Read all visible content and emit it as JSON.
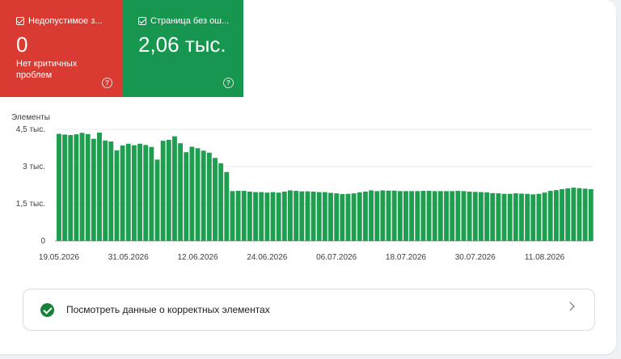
{
  "tiles": [
    {
      "title": "Недопустимое з...",
      "value": "0",
      "subtitle": "Нет критичных проблем",
      "color": "#d93b33"
    },
    {
      "title": "Страница без ош...",
      "value": "2,06 тыс.",
      "subtitle": "",
      "color": "#17964f"
    }
  ],
  "chart_data": {
    "type": "bar",
    "ylabel": "Элементы",
    "ylim": [
      0,
      4500
    ],
    "y_ticks": [
      "4,5 тыс.",
      "3 тыс.",
      "1,5 тыс.",
      "0"
    ],
    "y_tick_values": [
      4500,
      3000,
      1500,
      0
    ],
    "x_tick_labels": [
      "19.05.2026",
      "31.05.2026",
      "12.06.2026",
      "24.06.2026",
      "06.07.2026",
      "18.07.2026",
      "30.07.2026",
      "11.08.2026"
    ],
    "bar_color": "#1e9e4f",
    "values": [
      4320,
      4290,
      4270,
      4300,
      4360,
      4310,
      4120,
      4370,
      4050,
      4010,
      3650,
      3850,
      3920,
      3860,
      3920,
      3870,
      3790,
      3280,
      4040,
      4080,
      4220,
      3940,
      3580,
      3800,
      3740,
      3640,
      3560,
      3350,
      3130,
      2780,
      2010,
      2020,
      2020,
      1990,
      1970,
      1970,
      1950,
      1970,
      1950,
      1990,
      2040,
      2020,
      2000,
      2000,
      1990,
      1970,
      1970,
      1940,
      1920,
      1890,
      1900,
      1920,
      1960,
      1990,
      2040,
      2010,
      2040,
      2030,
      2030,
      2010,
      2010,
      2010,
      2010,
      2020,
      2020,
      2010,
      2010,
      2010,
      2010,
      2020,
      2010,
      1990,
      1980,
      1970,
      1960,
      1930,
      1920,
      1900,
      1900,
      1920,
      1910,
      1900,
      1880,
      1900,
      1950,
      2020,
      2050,
      2090,
      2120,
      2150,
      2130,
      2110,
      2090
    ]
  },
  "link": {
    "label": "Посмотреть данные о корректных элементах"
  }
}
